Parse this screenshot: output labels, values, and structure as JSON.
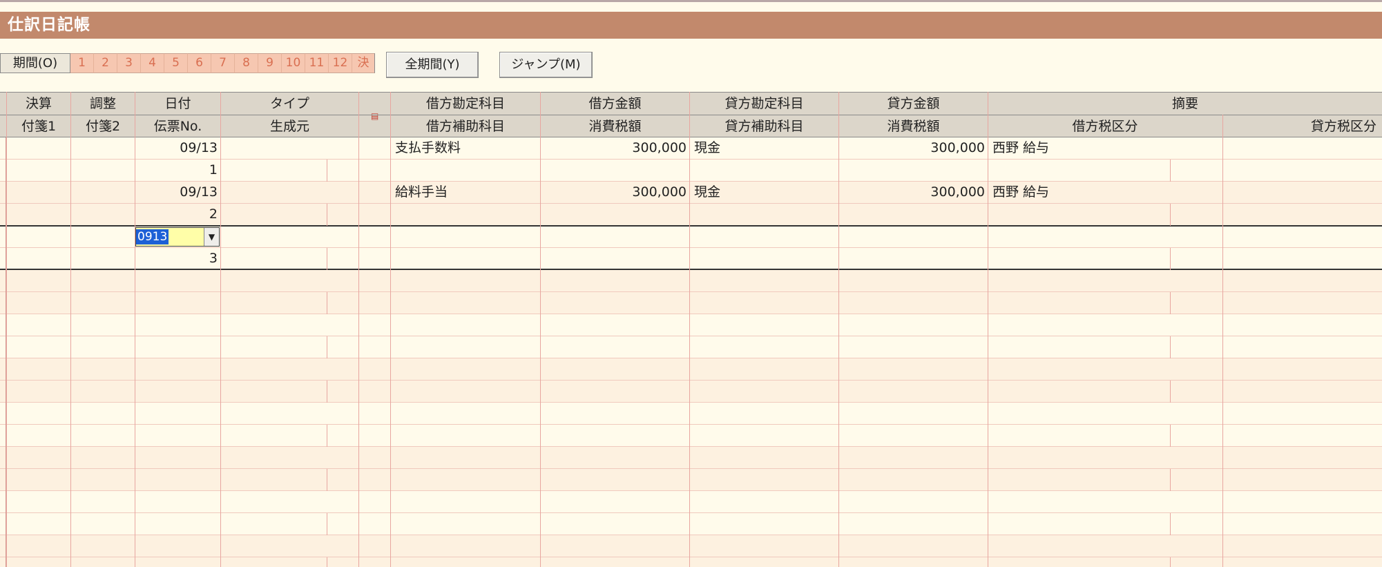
{
  "title": "仕訳日記帳",
  "period": {
    "label": "期間(O)",
    "months": [
      "1",
      "2",
      "3",
      "4",
      "5",
      "6",
      "7",
      "8",
      "9",
      "10",
      "11",
      "12",
      "決"
    ]
  },
  "buttons": {
    "all_period": "全期間(Y)",
    "jump": "ジャンプ(M)"
  },
  "header": {
    "row1": {
      "kessan": "決算",
      "chousei": "調整",
      "hizuke": "日付",
      "type": "タイプ",
      "debit_account": "借方勘定科目",
      "debit_amount": "借方金額",
      "credit_account": "貸方勘定科目",
      "credit_amount": "貸方金額",
      "memo": "摘要"
    },
    "row2": {
      "fusen1": "付箋1",
      "fusen2": "付箋2",
      "denpyo": "伝票No.",
      "source": "生成元",
      "debit_sub": "借方補助科目",
      "debit_tax": "消費税額",
      "credit_sub": "貸方補助科目",
      "credit_tax": "消費税額",
      "debit_tax_cat": "借方税区分",
      "credit_tax_cat": "貸方税区分"
    },
    "icon": "note-icon"
  },
  "entries": [
    {
      "date": "09/13",
      "no": "1",
      "debit_account": "支払手数料",
      "debit_amount": "300,000",
      "credit_account": "現金",
      "credit_amount": "300,000",
      "memo": "西野  給与"
    },
    {
      "date": "09/13",
      "no": "2",
      "debit_account": "給料手当",
      "debit_amount": "300,000",
      "credit_account": "現金",
      "credit_amount": "300,000",
      "memo": "西野  給与"
    }
  ],
  "editing": {
    "date_value": "0913",
    "no": "3"
  },
  "colors": {
    "title_bar": "#c2896c",
    "month_bg": "#f6c7b1",
    "selection": "#1d60d6",
    "input_bg": "#fffea8"
  }
}
